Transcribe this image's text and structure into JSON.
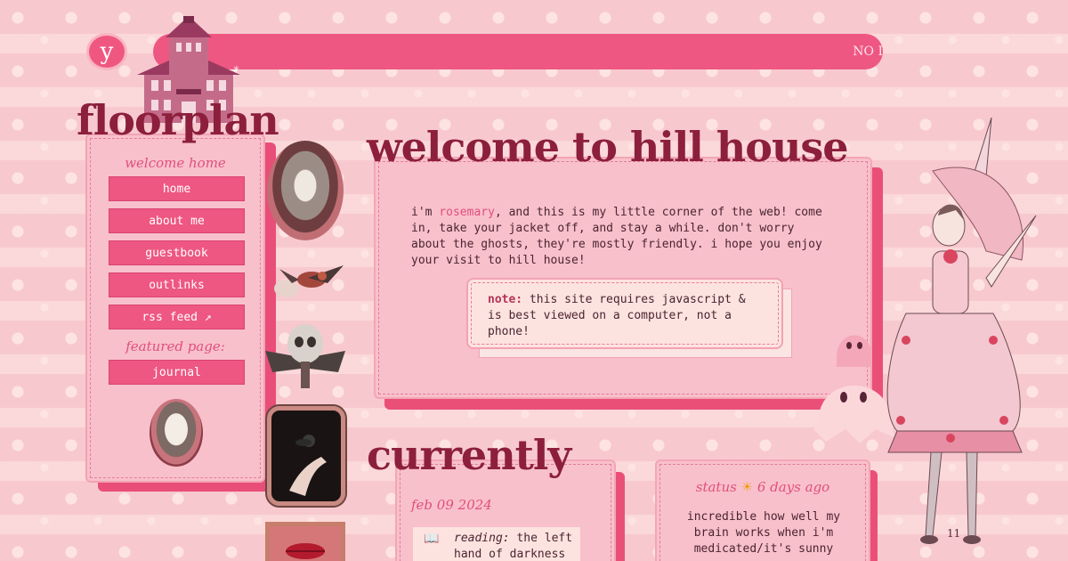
{
  "header": {
    "logo_letter": "y",
    "marquee": "NO I"
  },
  "sidebar": {
    "title": "floorplan",
    "subtitle": "welcome home",
    "nav": [
      {
        "label": "home"
      },
      {
        "label": "about me"
      },
      {
        "label": "guestbook"
      },
      {
        "label": "outlinks"
      },
      {
        "label": "rss feed ↗"
      }
    ],
    "featured_label": "featured page:",
    "featured_item": "journal"
  },
  "welcome": {
    "title": "welcome to hill house",
    "intro_before": "i'm ",
    "name": "rosemary",
    "intro_after": ", and this is my little corner of the web! come in, take your jacket off, and stay a while. don't worry about the ghosts, they're mostly friendly. i hope you enjoy your visit to hill house!",
    "note_label": "note:",
    "note_text": " this site requires javascript & is best viewed on a computer, not a phone!"
  },
  "currently": {
    "title": "currently",
    "date": "feb 09 2024",
    "reading_label": "reading:",
    "reading_text": " the left hand of darkness -",
    "reading_icon": "book-icon"
  },
  "status": {
    "label": "status",
    "icon": "sun-icon",
    "age": "6 days ago",
    "text": "incredible how well my brain works when i'm medicated/it's sunny"
  },
  "page_number": "11",
  "colors": {
    "accent": "#ee5781",
    "title": "#8c1f3c",
    "panel": "#f8c0cb",
    "background": "#f7c9ce"
  }
}
